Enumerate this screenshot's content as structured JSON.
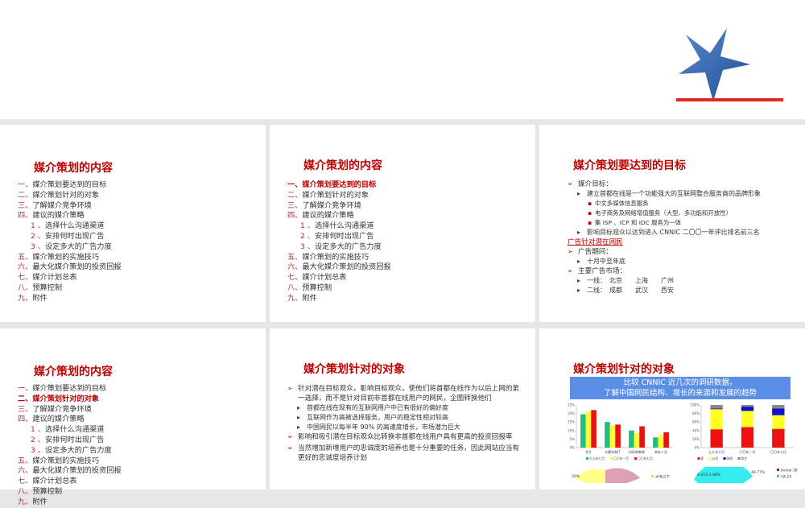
{
  "toc": {
    "title": "媒介策划的内容",
    "items": [
      {
        "num": "一、",
        "text": "媒介策划要达到的目标"
      },
      {
        "num": "二、",
        "text": "媒介策划针对的对象"
      },
      {
        "num": "三、",
        "text": "了解媒介竞争环境"
      },
      {
        "num": "四、",
        "text": "建议的媒介策略"
      },
      {
        "num": "1 、",
        "text": "选择什么沟通渠道",
        "sub": true
      },
      {
        "num": "2 、",
        "text": "安排何时出现广告",
        "sub": true
      },
      {
        "num": "3 、",
        "text": "设定多大的广告力度",
        "sub": true
      },
      {
        "num": "五、",
        "text": "媒介策划的实施技巧"
      },
      {
        "num": "六、",
        "text": "最大化媒介策划的投资回报"
      },
      {
        "num": "七、",
        "text": "媒介计划总表"
      },
      {
        "num": "八、",
        "text": "预算控制"
      },
      {
        "num": "九、",
        "text": "附件"
      }
    ]
  },
  "goals": {
    "title": "媒介策划要达到的目标",
    "media_goal": "媒介目标：",
    "brand": "建立首都在线是一个功能强大的互联网整合服务商的品牌形象",
    "services": [
      "中文多媒体信息服务",
      "电子商务及网络增值服务（大型、多功能和开放性）",
      "集 ISP 、ICP 和 IDC 服务为一体"
    ],
    "influence": "影响目标观众以达到进入 CNNIC 二〇〇一年评比排名前三名",
    "link": "广告针对潜在网民",
    "period_label": "广告期间：",
    "period": "十月中至年底",
    "market_label": "主要广告市场：",
    "tier1": "一线：　北京　　上海　　广州",
    "tier2": "二线：　成都　　武汉　　西安"
  },
  "target": {
    "title": "媒介策划针对的对象",
    "p1": "针对潜在目标观众，影响目标观众，使他们将首都在线作为以后上网的第一选择，而不是针对目前非首都在线用户的网民，企图转换他们",
    "s1": "首都在线在现有的互联网用户中已有很好的偏好度",
    "s2": "互联网作为高被选择服务，用户的稳定性相对较高",
    "s3": "中国网民以每半年 90% 的高速度增长，市场潜力巨大",
    "p2": "影响和吸引潜在目标观众比转换非首都在线用户具有更高的投资回报率",
    "p3": "当然增加新增用户的忠诚度的培养也是十分重要的任务，因此网站应当有更好的忠诚度培养计划"
  },
  "cnnic": {
    "title": "媒介策划针对的对象",
    "banner1": "比较 CNNIC 近几次的调研数据，",
    "banner2": "了解中国网民结构、增长的来源和发展的趋势",
    "pie1_labels": [
      "30%",
      "大专以下"
    ],
    "pie2_labels": [
      "0.41%",
      "1.68%",
      "48.77%",
      "below 18",
      "18-24"
    ]
  },
  "chart_data": [
    {
      "type": "bar",
      "categories": [
        "学生",
        "计算机和IT",
        "科研和教育",
        "商务人员"
      ],
      "series": [
        {
          "name": "九九年七月",
          "color": "#1fbf7f",
          "values": [
            19.5,
            15,
            10,
            6
          ]
        },
        {
          "name": "〇〇年一月",
          "color": "#ffff33",
          "values": [
            21,
            13,
            8.5,
            7.5
          ]
        },
        {
          "name": "〇〇年七月",
          "color": "#e81010",
          "values": [
            22,
            13.5,
            12.5,
            9
          ]
        }
      ],
      "yticks": [
        "0%",
        "5%",
        "10%",
        "15%",
        "20%",
        "25%"
      ],
      "ylim": [
        0,
        25
      ]
    },
    {
      "type": "bar",
      "stacked": true,
      "categories": [
        "九九年七月",
        "〇〇年一月",
        "〇〇年七月"
      ],
      "series": [
        {
          "name": "家",
          "color": "#ee1111",
          "values": [
            43,
            48,
            44
          ]
        },
        {
          "name": "公司",
          "color": "#ffff22",
          "values": [
            47,
            38,
            32
          ]
        },
        {
          "name": "网吧",
          "color": "#1010cc",
          "values": [
            2,
            10,
            16
          ]
        },
        {
          "name": "其它",
          "color": "#888888",
          "values": [
            8,
            4,
            8
          ]
        }
      ],
      "yticks": [
        "0%",
        "20%",
        "40%",
        "60%",
        "80%",
        "100%"
      ],
      "ylim": [
        0,
        100
      ]
    }
  ]
}
